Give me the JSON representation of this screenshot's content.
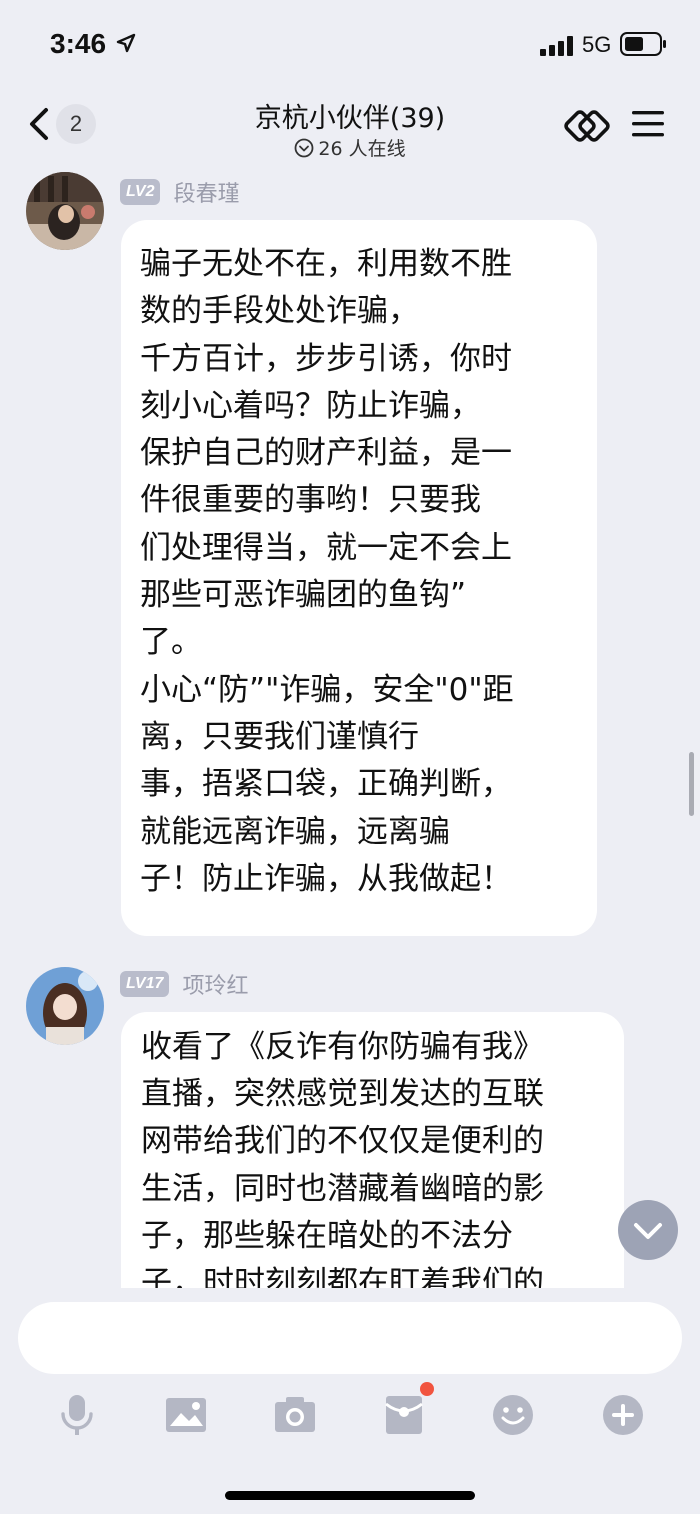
{
  "status": {
    "time": "3:46",
    "network": "5G"
  },
  "header": {
    "back_count": "2",
    "title": "京杭小伙伴(39)",
    "online": "26 人在线"
  },
  "messages": [
    {
      "level": "LV2",
      "sender": "段春瑾",
      "lines": [
        "骗子无处不在，利用数不胜",
        "数的手段处处诈骗，",
        "千方百计，步步引诱，你时",
        "刻小心着吗？防止诈骗，",
        "保护自己的财产利益，是一",
        "件很重要的事哟！只要我",
        "们处理得当，就一定不会上",
        "那些可恶诈骗团的鱼钩”",
        "了。",
        "小心“防”\"诈骗，安全\"0\"距",
        "离，只要我们谨慎行",
        "事，捂紧口袋，正确判断，",
        "就能远离诈骗，远离骗",
        "子！防止诈骗，从我做起！"
      ]
    },
    {
      "level": "LV17",
      "sender": "项玲红",
      "lines": [
        "收看了《反诈有你防骗有我》",
        "直播，突然感觉到发达的互联",
        "网带给我们的不仅仅是便利的",
        "生活，同时也潜藏着幽暗的影",
        "子，那些躲在暗处的不法分",
        "子，时时刻刻都在盯着我们的"
      ]
    }
  ],
  "toolbar": [
    "mic-icon",
    "image-icon",
    "camera-icon",
    "red-packet-icon",
    "emoji-icon",
    "plus-icon"
  ]
}
